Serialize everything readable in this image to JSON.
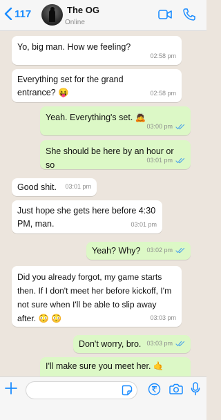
{
  "header": {
    "back_count": "117",
    "contact_name": "The OG",
    "contact_status": "Online"
  },
  "messages": [
    {
      "direction": "in",
      "text": "Yo, big man. How we feeling?",
      "time": "02:58 pm"
    },
    {
      "direction": "in",
      "text": "Everything set for the grand entrance? 😝",
      "time": "02:58 pm"
    },
    {
      "direction": "out",
      "text": "Yeah. Everything's set. 🙇",
      "time": "03:00 pm",
      "read": true
    },
    {
      "direction": "out",
      "text": "She should be here by an hour or so",
      "time": "03:01 pm",
      "read": true
    },
    {
      "direction": "in",
      "text": "Good shit.",
      "time": "03:01 pm"
    },
    {
      "direction": "in",
      "text": "Just hope she gets here before 4:30 PM, man.",
      "time": "03:01 pm"
    },
    {
      "direction": "out",
      "text": "Yeah? Why?",
      "time": "03:02 pm",
      "read": true
    },
    {
      "direction": "in",
      "text": "Did you already forgot, my game starts then. If I don't meet her before kickoff, I'm not sure when I'll be able to slip away after. 😳 😳",
      "time": "03:03 pm"
    },
    {
      "direction": "out",
      "text": "Don't worry, bro.",
      "time": "03:03 pm",
      "read": true
    },
    {
      "direction": "out",
      "text": "I'll make sure you meet her. 🤙",
      "time": ""
    }
  ],
  "composer": {
    "placeholder": ""
  },
  "colors": {
    "accent": "#1a8cff",
    "outgoing_bubble": "#dcf8c6",
    "incoming_bubble": "#ffffff",
    "chat_background": "#ece5dd",
    "read_ticks": "#4fa6e9"
  },
  "icons": {
    "back": "chevron-left-icon",
    "video": "video-camera-icon",
    "phone": "phone-icon",
    "plus": "plus-icon",
    "sticker": "sticker-icon",
    "payment": "rupee-icon",
    "camera": "camera-icon",
    "mic": "microphone-icon",
    "read": "double-check-icon"
  }
}
